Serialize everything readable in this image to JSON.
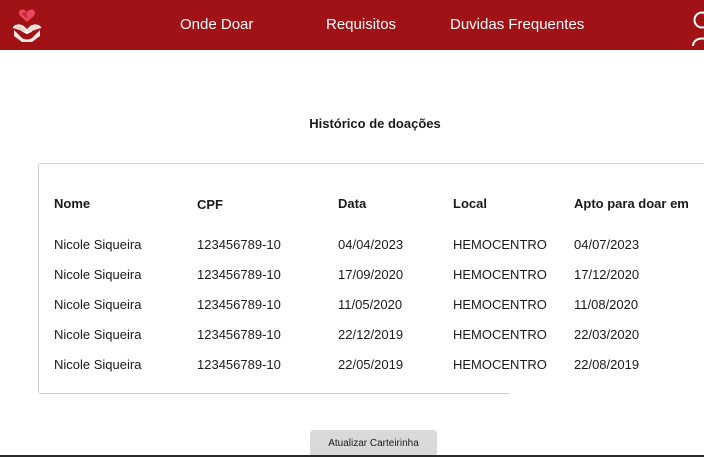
{
  "nav": {
    "items": [
      "Onde Doar",
      "Requisitos",
      "Duvidas Frequentes"
    ]
  },
  "colors": {
    "header": "#a01216",
    "button": "#d9d9d9"
  },
  "icons": {
    "logo": "heart-hands-icon",
    "user": "user-icon"
  },
  "page": {
    "title": "Histórico de doações"
  },
  "table": {
    "headers": [
      "Nome",
      "CPF",
      "Data",
      "Local",
      "Apto para doar em"
    ],
    "rows": [
      [
        "Nicole Siqueira",
        "123456789-10",
        "04/04/2023",
        "HEMOCENTRO",
        "04/07/2023"
      ],
      [
        "Nicole Siqueira",
        "123456789-10",
        "17/09/2020",
        "HEMOCENTRO",
        "17/12/2020"
      ],
      [
        "Nicole Siqueira",
        "123456789-10",
        "11/05/2020",
        "HEMOCENTRO",
        "11/08/2020"
      ],
      [
        "Nicole Siqueira",
        "123456789-10",
        "22/12/2019",
        "HEMOCENTRO",
        "22/03/2020"
      ],
      [
        "Nicole Siqueira",
        "123456789-10",
        "22/05/2019",
        "HEMOCENTRO",
        "22/08/2019"
      ]
    ]
  },
  "actions": {
    "update_card": "Atualizar Carteirinha"
  }
}
